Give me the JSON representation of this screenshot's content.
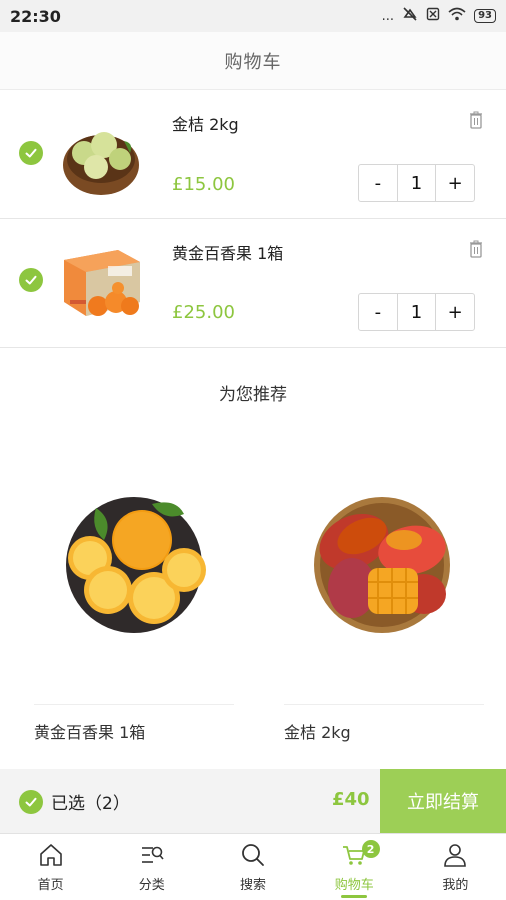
{
  "status_bar": {
    "time": "22:30",
    "signal": "...",
    "battery": "93"
  },
  "header": {
    "title": "购物车"
  },
  "cart": {
    "items": [
      {
        "name": "金桔 2kg",
        "price": "£15.00",
        "qty": "1",
        "minus": "-",
        "plus": "+",
        "selected": true,
        "image": "pears-basket"
      },
      {
        "name": "黄金百香果 1箱",
        "price": "£25.00",
        "qty": "1",
        "minus": "-",
        "plus": "+",
        "selected": true,
        "image": "orange-box"
      }
    ]
  },
  "recommend": {
    "title": "为您推荐",
    "items": [
      {
        "name": "黄金百香果 1箱",
        "image": "orange-plate"
      },
      {
        "name": "金桔 2kg",
        "image": "mango-bowl"
      }
    ]
  },
  "checkout": {
    "selected_label": "已选（2）",
    "total": "£40",
    "button": "立即结算"
  },
  "tabs": [
    {
      "label": "首页",
      "icon": "home-icon"
    },
    {
      "label": "分类",
      "icon": "category-icon"
    },
    {
      "label": "搜索",
      "icon": "search-icon"
    },
    {
      "label": "购物车",
      "icon": "cart-icon",
      "badge": "2",
      "active": true
    },
    {
      "label": "我的",
      "icon": "user-icon"
    }
  ],
  "colors": {
    "accent": "#8dc63f",
    "checkout_button": "#9dcf56"
  }
}
